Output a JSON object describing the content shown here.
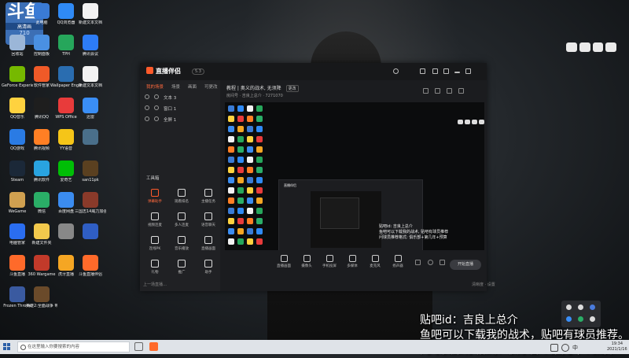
{
  "desktop": {
    "corner_badge": {
      "logo": "斗鱼",
      "label": "高清画",
      "number": "710"
    },
    "icons": [
      {
        "label": "此电脑",
        "color": "#3a7bd5"
      },
      {
        "label": "QQ浏览器",
        "color": "#2f8af5"
      },
      {
        "label": "新建文本文档",
        "color": "#f2f2f2"
      },
      {
        "label": "回收站",
        "color": "#9bb6d8"
      },
      {
        "label": "控制面板",
        "color": "#4a90e2"
      },
      {
        "label": "TPH",
        "color": "#26a65b"
      },
      {
        "label": "腾讯会议",
        "color": "#2d7cf6"
      },
      {
        "label": "GeForce Experience",
        "color": "#76b900"
      },
      {
        "label": "软件管家",
        "color": "#f05a28"
      },
      {
        "label": "Wallpaper Engine: 壁纸引擎",
        "color": "#2a6db0"
      },
      {
        "label": "新建文本文档",
        "color": "#f2f2f2"
      },
      {
        "label": "QQ音乐",
        "color": "#ffd23f"
      },
      {
        "label": "腾讯QQ",
        "color": "#1e1e1e"
      },
      {
        "label": "WPS Office",
        "color": "#e83b3b"
      },
      {
        "label": "迅雷",
        "color": "#3a8ef6"
      },
      {
        "label": "QQ游戏",
        "color": "#2a7be4"
      },
      {
        "label": "腾讯视频",
        "color": "#ff7f24"
      },
      {
        "label": "YY语音",
        "color": "#f5c518"
      },
      {
        "label": "",
        "color": "#4a6f8a"
      },
      {
        "label": "Steam",
        "color": "#1b2838"
      },
      {
        "label": "腾讯软件",
        "color": "#29a3e0"
      },
      {
        "label": "爱奇艺",
        "color": "#00be06"
      },
      {
        "label": "san11pk",
        "color": "#5a4020"
      },
      {
        "label": "WeGame",
        "color": "#d0a050"
      },
      {
        "label": "微信",
        "color": "#2aae67"
      },
      {
        "label": "百度网盘",
        "color": "#3b8cf0"
      },
      {
        "label": "三国志14威力加强版",
        "color": "#8a3a2a"
      },
      {
        "label": "电脑管家",
        "color": "#2a6df0"
      },
      {
        "label": "新建文件夹",
        "color": "#f2c94c"
      },
      {
        "label": "",
        "color": "#888888"
      },
      {
        "label": "",
        "color": "#2f5ec4"
      },
      {
        "label": "斗鱼直播",
        "color": "#ff6a2a"
      },
      {
        "label": "360 Wargame",
        "color": "#c23a2a"
      },
      {
        "label": "虎牙直播",
        "color": "#f5a623"
      },
      {
        "label": "斗鱼直播伴侣",
        "color": "#ff6a2a"
      },
      {
        "label": "Frozen Throne",
        "color": "#3a5aa0"
      },
      {
        "label": "英雄2:全面战争 带魔改",
        "color": "#6a4a2a"
      }
    ]
  },
  "app": {
    "logo": "直播伴侣",
    "version": "5.3",
    "left_tabs": [
      "我的场景",
      "场景",
      "画面",
      "可更改"
    ],
    "sources": [
      "文本 3",
      "窗口 1",
      "全屏 1"
    ],
    "toolbox_title": "工具箱",
    "tools": [
      "弹幕助手",
      "观看排名",
      "主播任务",
      "视频连麦",
      "多人连麦",
      "语音聊天",
      "连线PK",
      "音乐播放",
      "直播画面",
      "礼物",
      "推广",
      "助手"
    ],
    "room_title": "教程 | 奥义的战术, 无须降",
    "room_meta": "房间号 · 吉良上总介 · 7271070",
    "room_chip": "更改",
    "bottom_tools": [
      "直播画面",
      "摄像头",
      "手机投屏",
      "多媒体",
      "麦克风",
      "扬声器"
    ],
    "go_live": "开始直播",
    "status_left": "上一场直播…",
    "status_right": "清晰度 · 设置"
  },
  "preview_overlay": [
    "贴吧id: 吉良上总介",
    "鱼吧可以下载我的战术, 贴吧有球员推荐",
    "问球员推荐格式: 俱乐部+第几年+预算"
  ],
  "overlay_text": [
    "贴吧id：吉良上总介",
    "鱼吧可以下载我的战术，贴吧有球员推荐。",
    "问球员推荐格式：俱乐部+第几年+预算"
  ],
  "taskbar": {
    "search_placeholder": "在这里输入你要搜索的内容",
    "time": "19:34",
    "date": "2021/1/16"
  },
  "colors": {
    "accent": "#ff5a2a",
    "taskbar": "#dfe3e8"
  }
}
